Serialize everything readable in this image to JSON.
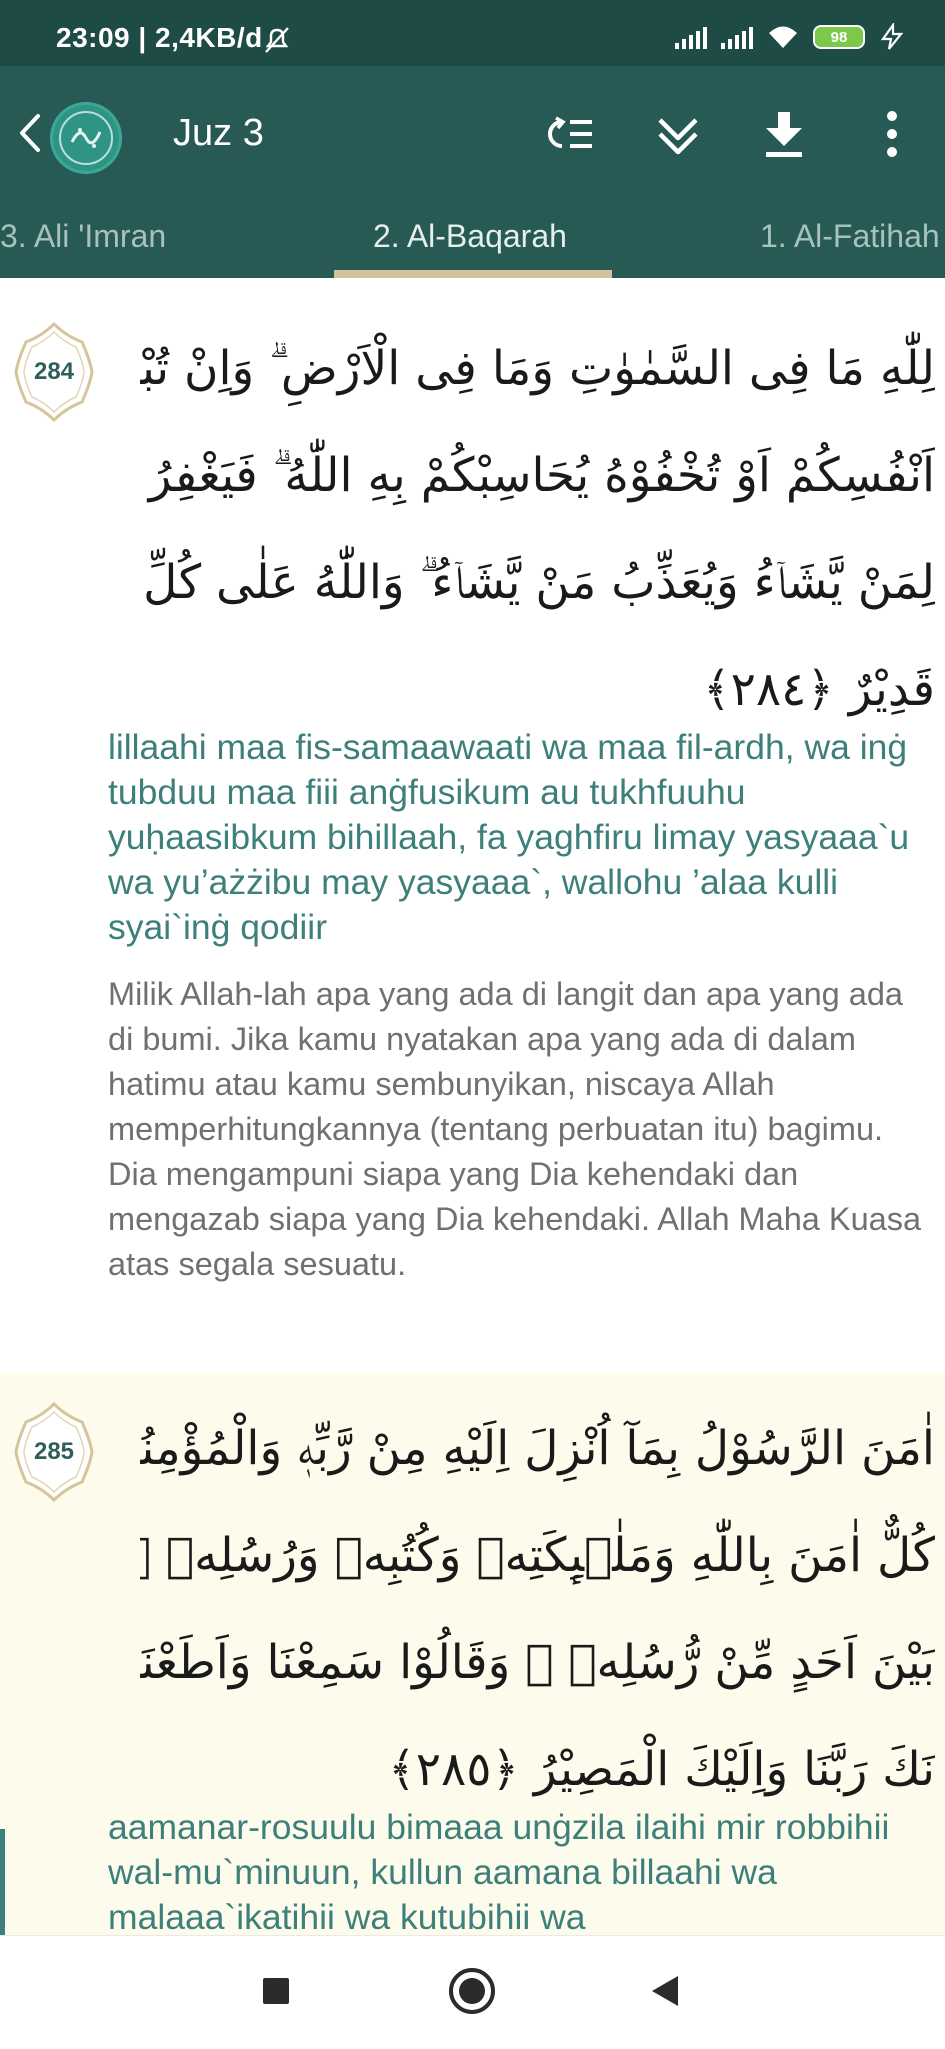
{
  "status_bar": {
    "time": "23:09 | 2,4KB/d",
    "battery": "98"
  },
  "app_bar": {
    "title": "Juz 3"
  },
  "tabs": [
    {
      "label": "3. Ali 'Imran"
    },
    {
      "label": "2. Al-Baqarah"
    },
    {
      "label": "1. Al-Fatihah"
    }
  ],
  "verses": [
    {
      "number": "284",
      "arabic_lines": [
        "لِلّٰهِ مَا فِى السَّمٰوٰتِ وَمَا فِى الْاَرْضِ ۗ وَاِنْ تُبْدُوْا مَا فِيْٓ",
        "اَنْفُسِكُمْ اَوْ تُخْفُوْهُ يُحَاسِبْكُمْ بِهِ اللّٰهُ ۗ فَيَغْفِرُ",
        "لِمَنْ يَّشَاۤءُ وَيُعَذِّبُ مَنْ يَّشَاۤءُ ۗ وَاللّٰهُ عَلٰى كُلِّ شَيْءٍ",
        "قَدِيْرٌ ﴿٢٨٤﴾"
      ],
      "transliteration": "lillaahi maa fis-samaawaati wa maa fil-ardh, wa inġ tubduu maa fiii anġfusikum au tukhfuuhu yuḥaasibkum bihillaah, fa yaghfiru limay yasyaaa`u wa yu’ażżibu may yasyaaa`, wallohu ’alaa kulli syai`inġ qodiir",
      "translation": "Milik Allah-lah apa yang ada di langit dan apa yang ada di bumi. Jika kamu nyatakan apa yang ada di dalam hatimu atau kamu sembunyikan, niscaya Allah memperhitungkannya (tentang perbuatan itu) bagimu. Dia mengampuni siapa yang Dia kehendaki dan mengazab siapa yang Dia kehendaki. Allah Maha Kuasa atas segala sesuatu."
    },
    {
      "number": "285",
      "arabic_lines": [
        "اٰمَنَ الرَّسُوْلُ بِمَآ اُنْزِلَ اِلَيْهِ مِنْ رَّبِّهٖ وَالْمُؤْمِنُوْنَ ۗ",
        "كُلٌّ اٰمَنَ بِاللّٰهِ وَمَلٰۤىِٕكَتِهٖ وَكُتُبِهٖ وَرُسُلِهٖ ۗ لَا نُفَرِّقُ",
        "بَيْنَ اَحَدٍ مِّنْ رُّسُلِهٖ ۗ وَقَالُوْا سَمِعْنَا وَاَطَعْنَا غُفْرَا",
        "نَكَ رَبَّنَا وَاِلَيْكَ الْمَصِيْرُ ﴿٢٨٥﴾"
      ],
      "transliteration": "aamanar-rosuulu bimaaa unġzila ilaihi mir robbihii wal-mu`minuun, kullun aamana billaahi wa malaaa`ikatihii wa kutubihii wa"
    }
  ],
  "colors": {
    "status_bar": "#1f4b47",
    "app_bar": "#275a55",
    "tab_indicator": "#d4c29e",
    "transliteration": "#3d7f7a",
    "translation": "#707070",
    "highlight_background": "#fdfbec"
  },
  "icons": {
    "back": "chevron-left-icon",
    "logo": "quran-logo-icon",
    "settings_list": "list-loop-icon",
    "expand": "double-chevron-down-icon",
    "download": "download-icon",
    "menu": "more-vertical-icon",
    "nav_recent": "square-icon",
    "nav_home": "circle-icon",
    "nav_back": "triangle-back-icon"
  }
}
